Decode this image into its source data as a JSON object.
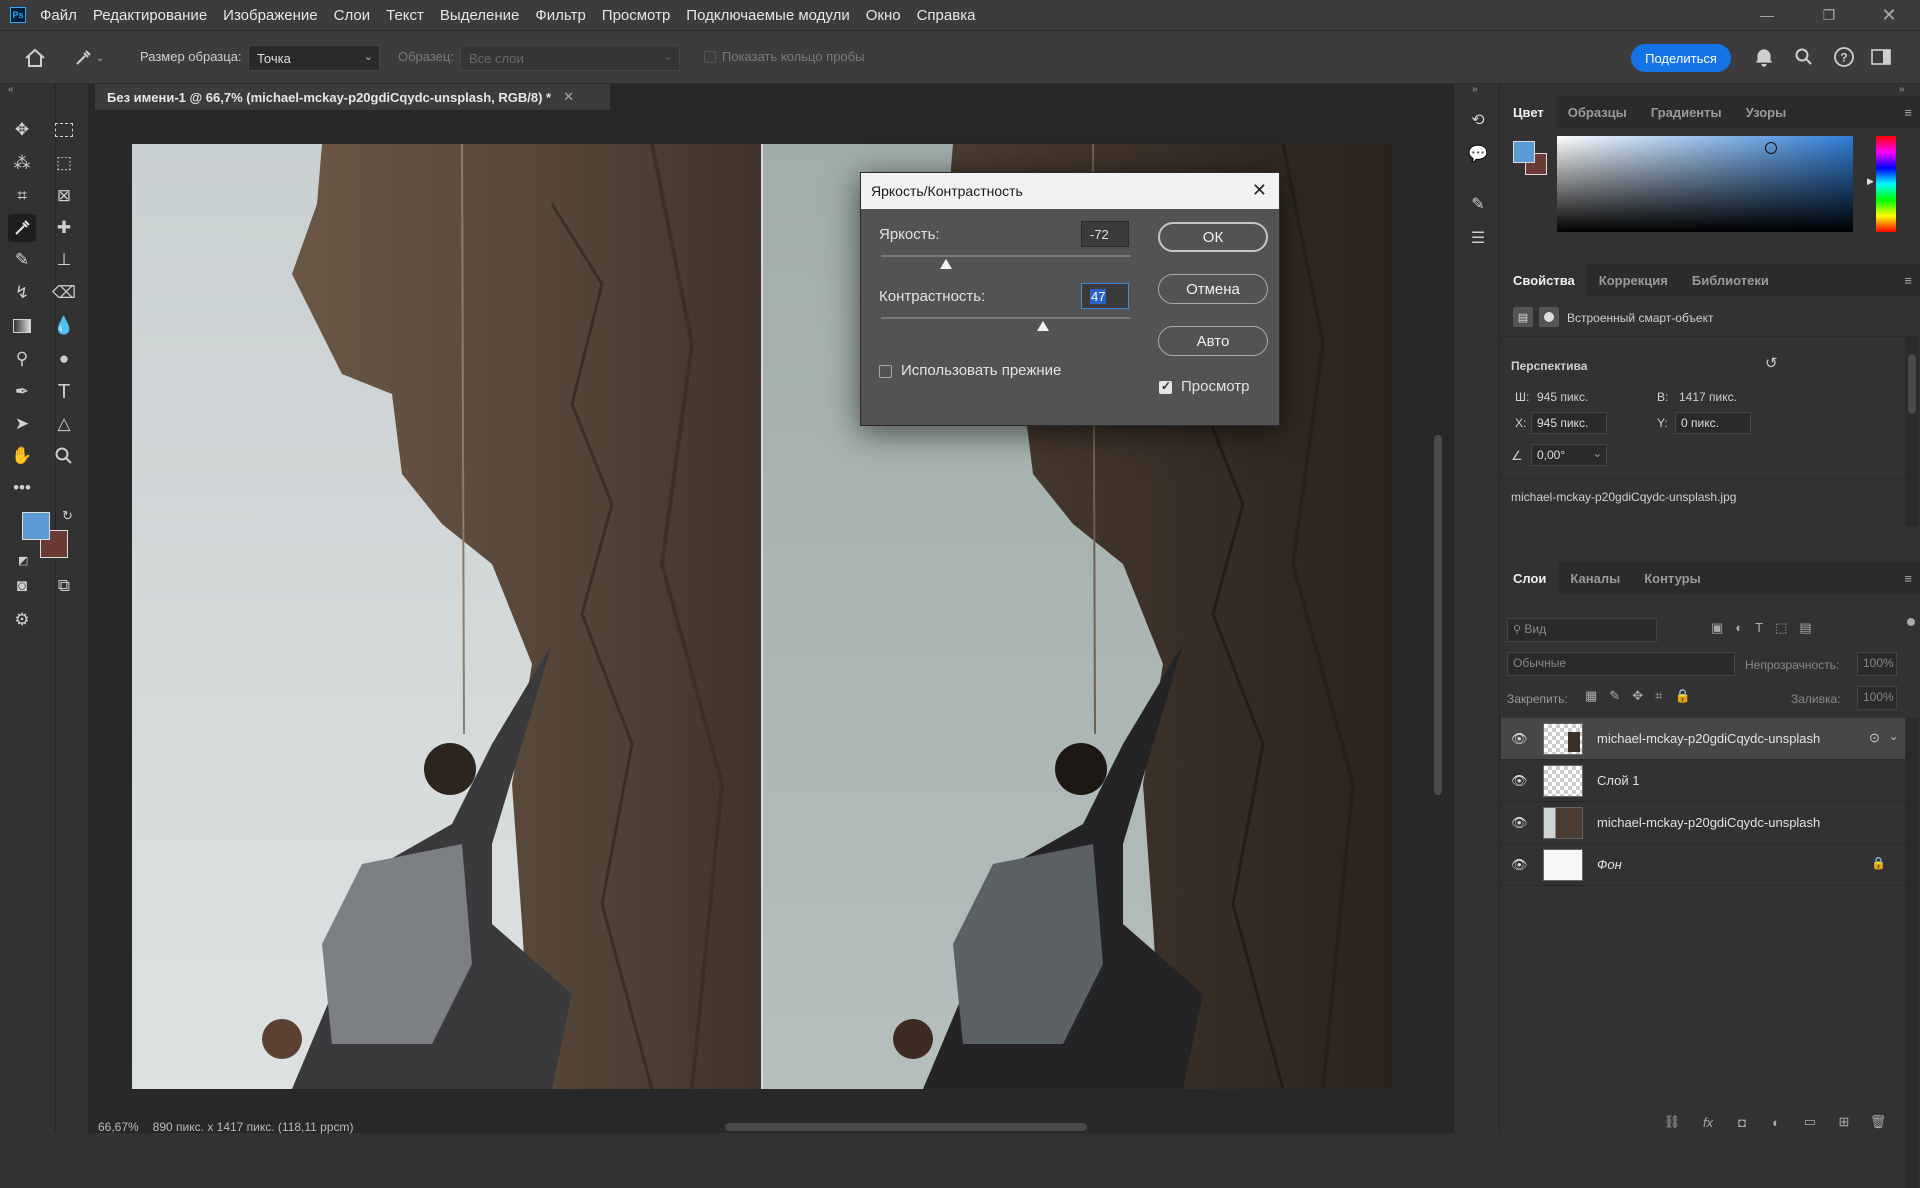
{
  "menubar": {
    "logo": "Ps",
    "items": [
      "Файл",
      "Редактирование",
      "Изображение",
      "Слои",
      "Текст",
      "Выделение",
      "Фильтр",
      "Просмотр",
      "Подключаемые модули",
      "Окно",
      "Справка"
    ]
  },
  "options_bar": {
    "sample_size_label": "Размер образца:",
    "sample_size_value": "Точка",
    "sample_label": "Образец:",
    "sample_value": "Все слои",
    "show_ring_label": "Показать кольцо пробы",
    "share_label": "Поделиться"
  },
  "document": {
    "tab_title": "Без имени-1 @ 66,7% (michael-mckay-p20gdiCqydc-unsplash, RGB/8) *",
    "status_zoom": "66,67%",
    "status_info": "890 пикс. x 1417 пикс. (118,11 ppcm)"
  },
  "dialog": {
    "title": "Яркость/Контрастность",
    "brightness_label": "Яркость:",
    "brightness_value": "-72",
    "brightness_level": -72,
    "contrast_label": "Контрастность:",
    "contrast_value": "47",
    "contrast_level": 47,
    "use_legacy_label": "Использовать прежние",
    "use_legacy_checked": false,
    "preview_label": "Просмотр",
    "preview_checked": true,
    "ok_label": "ОК",
    "cancel_label": "Отмена",
    "auto_label": "Авто"
  },
  "color_panel": {
    "tabs": [
      "Цвет",
      "Образцы",
      "Градиенты",
      "Узоры"
    ],
    "foreground": "#5b9bd5",
    "background": "#6b3a35"
  },
  "properties_panel": {
    "tabs": [
      "Свойства",
      "Коррекция",
      "Библиотеки"
    ],
    "object_type": "Встроенный смарт-объект",
    "section": "Перспектива",
    "w_label": "Ш:",
    "w_value": "945 пикс.",
    "h_label": "В:",
    "h_value": "1417 пикс.",
    "x_label": "X:",
    "x_value": "945 пикс.",
    "y_label": "Y:",
    "y_value": "0 пикс.",
    "angle_value": "0,00°",
    "filename": "michael-mckay-p20gdiCqydc-unsplash.jpg"
  },
  "layers_panel": {
    "tabs": [
      "Слои",
      "Каналы",
      "Контуры"
    ],
    "search_placeholder": "Вид",
    "blend_mode": "Обычные",
    "opacity_label": "Непрозрачность:",
    "opacity_value": "100%",
    "lock_label": "Закрепить:",
    "fill_label": "Заливка:",
    "fill_value": "100%",
    "layers": [
      {
        "name": "michael-mckay-p20gdiCqydc-unsplash",
        "selected": true
      },
      {
        "name": "Слой 1",
        "selected": false
      },
      {
        "name": "michael-mckay-p20gdiCqydc-unsplash",
        "selected": false
      },
      {
        "name": "Фон",
        "selected": false
      }
    ]
  }
}
